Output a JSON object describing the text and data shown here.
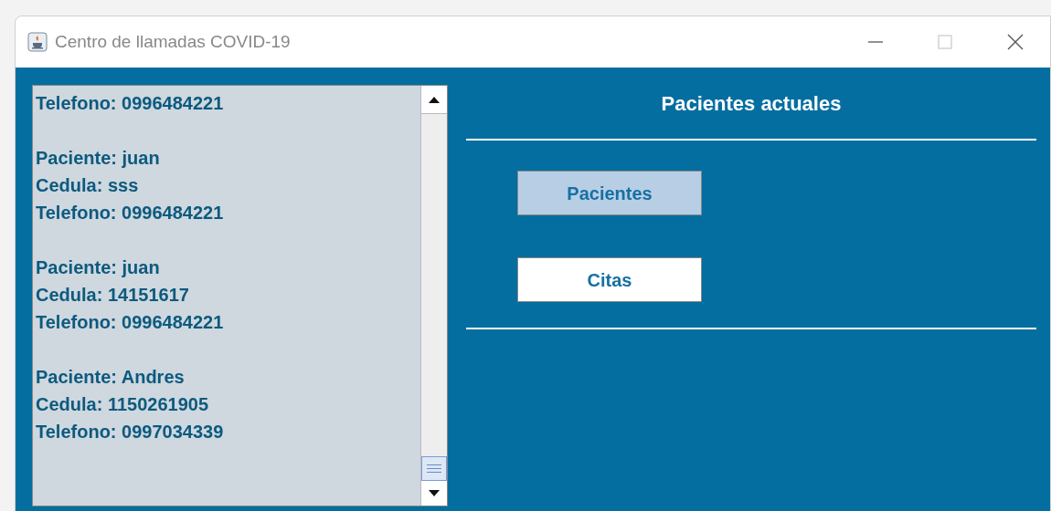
{
  "window": {
    "title": "Centro de llamadas COVID-19"
  },
  "patient_list": [
    [
      "Telefono: 0996484221"
    ],
    [
      "Paciente: juan",
      "Cedula: sss",
      "Telefono: 0996484221"
    ],
    [
      "Paciente: juan",
      "Cedula: 14151617",
      "Telefono: 0996484221"
    ],
    [
      "Paciente: Andres",
      "Cedula: 1150261905",
      "Telefono: 0997034339"
    ]
  ],
  "panel": {
    "title": "Pacientes actuales"
  },
  "buttons": [
    {
      "label": "Pacientes",
      "selected": true
    },
    {
      "label": "Citas",
      "selected": false
    }
  ]
}
